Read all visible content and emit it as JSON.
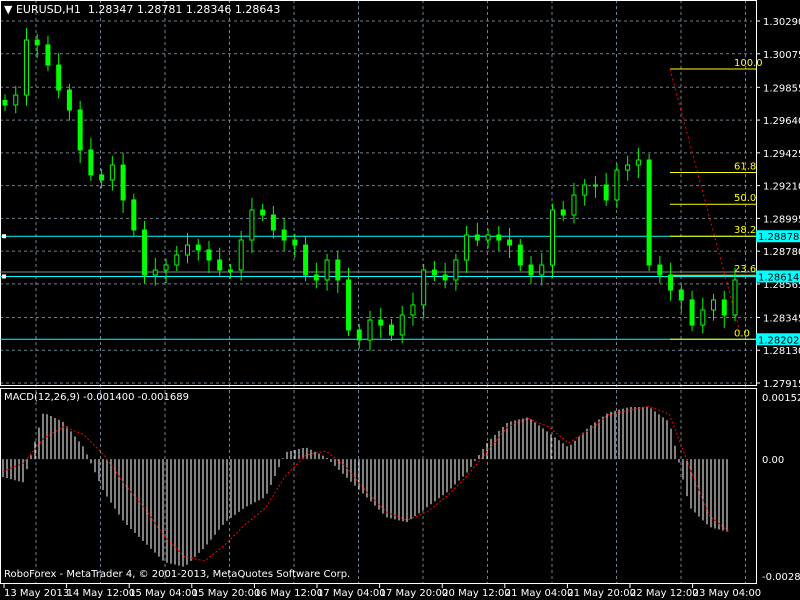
{
  "header": {
    "symbol": "EURUSD,H1",
    "ohlc": "1.28347 1.28781 1.28346 1.28643",
    "menu_icon": "triangle-down-icon"
  },
  "macd_header": "MACD(12,26,9) -0.001400 -0.001689",
  "copyright": "RoboForex - MetaTrader 4, © 2001-2013, MetaQuotes Software Corp.",
  "colors": {
    "candle": "#00ff00",
    "grid": "#708090",
    "hline": "#00ffff",
    "fibo": "#ffff00",
    "signal": "#ff0000",
    "hist": "#ffffff"
  },
  "chart_data": [
    {
      "type": "candlestick",
      "title": "EURUSD,H1",
      "price_ticks": [
        "1.30290",
        "1.30075",
        "1.29855",
        "1.29640",
        "1.29425",
        "1.29210",
        "1.28995",
        "1.28780",
        "1.28565",
        "1.28345",
        "1.28130",
        "1.27915"
      ],
      "ylim": [
        1.27915,
        1.3029
      ],
      "x_ticks": [
        "13 May 2013",
        "14 May 12:00",
        "15 May 04:00",
        "15 May 20:00",
        "16 May 12:00",
        "17 May 04:00",
        "17 May 20:00",
        "20 May 12:00",
        "21 May 04:00",
        "21 May 20:00",
        "22 May 12:00",
        "23 May 04:00"
      ],
      "closes": [
        1.29739,
        1.29804,
        1.30165,
        1.30133,
        1.30001,
        1.29837,
        1.29706,
        1.29444,
        1.2928,
        1.29247,
        1.29345,
        1.29116,
        1.28919,
        1.28624,
        1.28656,
        1.28689,
        1.28755,
        1.2882,
        1.28788,
        1.28722,
        1.28656,
        1.28656,
        1.28853,
        1.2905,
        1.29017,
        1.28919,
        1.28853,
        1.2882,
        1.28624,
        1.28591,
        1.28722,
        1.28591,
        1.28263,
        1.28197,
        1.28328,
        1.28295,
        1.2823,
        1.28361,
        1.28427,
        1.28656,
        1.28624,
        1.28591,
        1.28722,
        1.28886,
        1.28853,
        1.28886,
        1.28853,
        1.2882,
        1.28689,
        1.28624,
        1.28689,
        1.2905,
        1.29017,
        1.29148,
        1.29214,
        1.29214,
        1.29116,
        1.29312,
        1.29345,
        1.29378,
        1.28689,
        1.28624,
        1.28525,
        1.2846,
        1.28295,
        1.28394,
        1.2846,
        1.28361,
        1.28591
      ],
      "price_lines": [
        {
          "label": "1.28878",
          "value": 1.28878
        },
        {
          "label": "1.28614",
          "value": 1.28614
        },
        {
          "label": "1.28202",
          "value": 1.28202
        }
      ],
      "bid_line": 1.28643,
      "fibonacci": [
        {
          "label": "100.0",
          "value": 1.29975
        },
        {
          "label": "61.8",
          "value": 1.29296
        },
        {
          "label": "50.0",
          "value": 1.29088
        },
        {
          "label": "38.2",
          "value": 1.28878
        },
        {
          "label": "23.6",
          "value": 1.28622
        },
        {
          "label": "0.0",
          "value": 1.28202
        }
      ]
    },
    {
      "type": "bar+line",
      "title": "MACD(12,26,9)",
      "ticks": [
        "0.001527",
        "0.00",
        "-0.002871"
      ],
      "ylim": [
        -0.002871,
        0.001527
      ],
      "histogram": [
        -0.00044,
        -0.00057,
        0.00115,
        0.00091,
        0.00029,
        -0.00081,
        -0.00155,
        -0.00204,
        -0.00253,
        -0.00265,
        -0.00216,
        -0.00155,
        -0.00118,
        -0.00093,
        0.00017,
        0.00029,
        5e-05,
        -0.00044,
        -0.00093,
        -0.00143,
        -0.00155,
        -0.00118,
        -0.00081,
        -0.00032,
        0.00042,
        0.00091,
        0.00103,
        0.00066,
        0.00029,
        0.00079,
        0.00115,
        0.00128,
        0.00128,
        0.00091,
        -0.00118,
        -0.00167,
        -0.0018
      ],
      "signal": [
        -0.0003,
        -0.0001,
        0.0005,
        0.0008,
        0.0006,
        0.0001,
        -0.0006,
        -0.0012,
        -0.0019,
        -0.0024,
        -0.0025,
        -0.0021,
        -0.0016,
        -0.0012,
        -0.0004,
        0.0001,
        0.0002,
        -0.0002,
        -0.0008,
        -0.0013,
        -0.0015,
        -0.0013,
        -0.0009,
        -0.0004,
        0.0002,
        0.0008,
        0.001,
        0.0008,
        0.0004,
        0.0007,
        0.0011,
        0.0012,
        0.0013,
        0.0011,
        -0.0002,
        -0.0014,
        -0.0018
      ]
    }
  ]
}
